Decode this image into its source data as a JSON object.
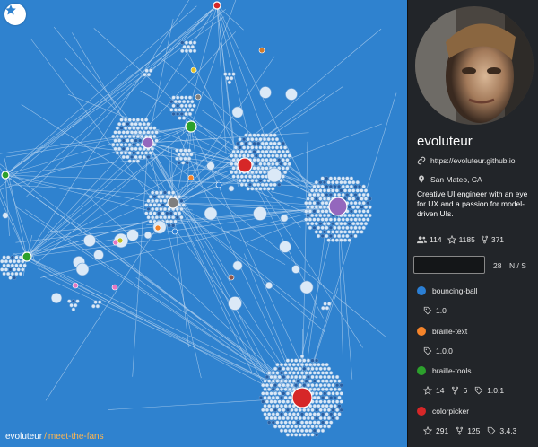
{
  "graph": {
    "breadcrumb": {
      "user": "evoluteur",
      "separator": "/",
      "repo": "meet-the-fans"
    },
    "palette": {
      "background": "#2f82cf",
      "link": "#bcd6f0",
      "fan_fill": "#dbe9f7",
      "fan_stroke": "#6fa2d6",
      "fan_dark": "#2a5fa2"
    }
  },
  "profile": {
    "username": "evoluteur",
    "website": "https://evoluteur.github.io",
    "location": "San Mateo, CA",
    "bio": "Creative UI engineer with an eye for UX and a passion for model-driven UIs.",
    "followers": "114",
    "stars": "1185",
    "forks": "371"
  },
  "filter": {
    "search_value": "",
    "count": "28",
    "sort_label": "N / S"
  },
  "repos": [
    {
      "name": "bouncing-ball",
      "color": "#2b7fd4",
      "version": "1.0"
    },
    {
      "name": "braille-text",
      "color": "#f5842a",
      "version": "1.0.0"
    },
    {
      "name": "braille-tools",
      "color": "#2ca02c",
      "stars": "14",
      "forks": "6",
      "version": "1.0.1"
    },
    {
      "name": "colorpicker",
      "color": "#d62728",
      "stars": "291",
      "forks": "125",
      "version": "3.4.3"
    }
  ]
}
